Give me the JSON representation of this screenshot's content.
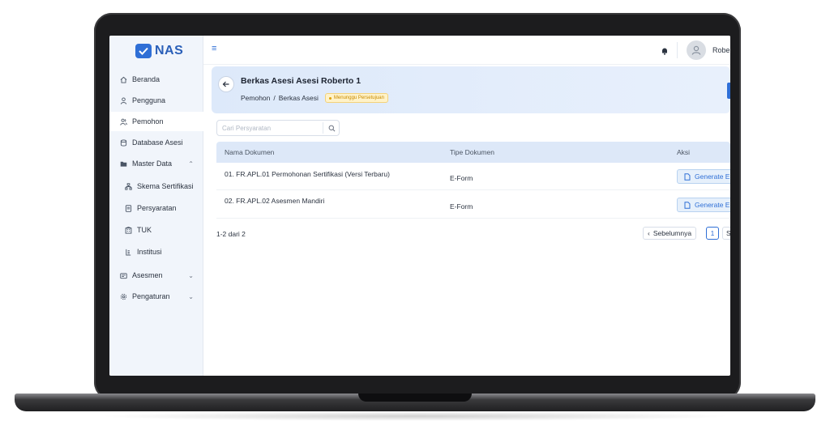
{
  "app": {
    "brand": "NAS"
  },
  "sidebar": {
    "items": [
      {
        "label": "Beranda",
        "icon": "home-icon"
      },
      {
        "label": "Pengguna",
        "icon": "user-icon"
      },
      {
        "label": "Pemohon",
        "icon": "users-icon",
        "active": true
      },
      {
        "label": "Database Asesi",
        "icon": "database-icon"
      },
      {
        "label": "Master Data",
        "icon": "folder-icon",
        "expanded": true
      },
      {
        "label": "Skema Sertifikasi",
        "icon": "hierarchy-icon"
      },
      {
        "label": "Persyaratan",
        "icon": "document-icon"
      },
      {
        "label": "TUK",
        "icon": "building-icon"
      },
      {
        "label": "Institusi",
        "icon": "institution-icon"
      },
      {
        "label": "Asesmen",
        "icon": "clipboard-icon"
      },
      {
        "label": "Pengaturan",
        "icon": "gear-icon"
      }
    ]
  },
  "topbar": {
    "username": "Robe"
  },
  "header": {
    "title": "Berkas Asesi Asesi Roberto 1",
    "breadcrumb": [
      "Pemohon",
      "/",
      "Berkas Asesi"
    ],
    "status_badge": "Menunggu Persetujuan"
  },
  "search": {
    "placeholder": "Cari Persyaratan"
  },
  "table": {
    "columns": [
      "Nama Dokumen",
      "Tipe Dokumen",
      "Aksi"
    ],
    "rows": [
      {
        "name": "01. FR.APL.01 Permohonan Sertifikasi (Versi Terbaru)",
        "type": "E-Form",
        "action": "Generate E"
      },
      {
        "name": "02. FR.APL.02 Asesmen Mandiri",
        "type": "E-Form",
        "action": "Generate E"
      }
    ]
  },
  "pagination": {
    "range": "1-2 dari 2",
    "prev": "Sebelumnya",
    "current_page": "1",
    "next": "S"
  },
  "colors": {
    "accent": "#2f6fd6",
    "banner": "#dde9fa",
    "badge": "#fff2c8",
    "sidebar": "#f1f5fb"
  }
}
